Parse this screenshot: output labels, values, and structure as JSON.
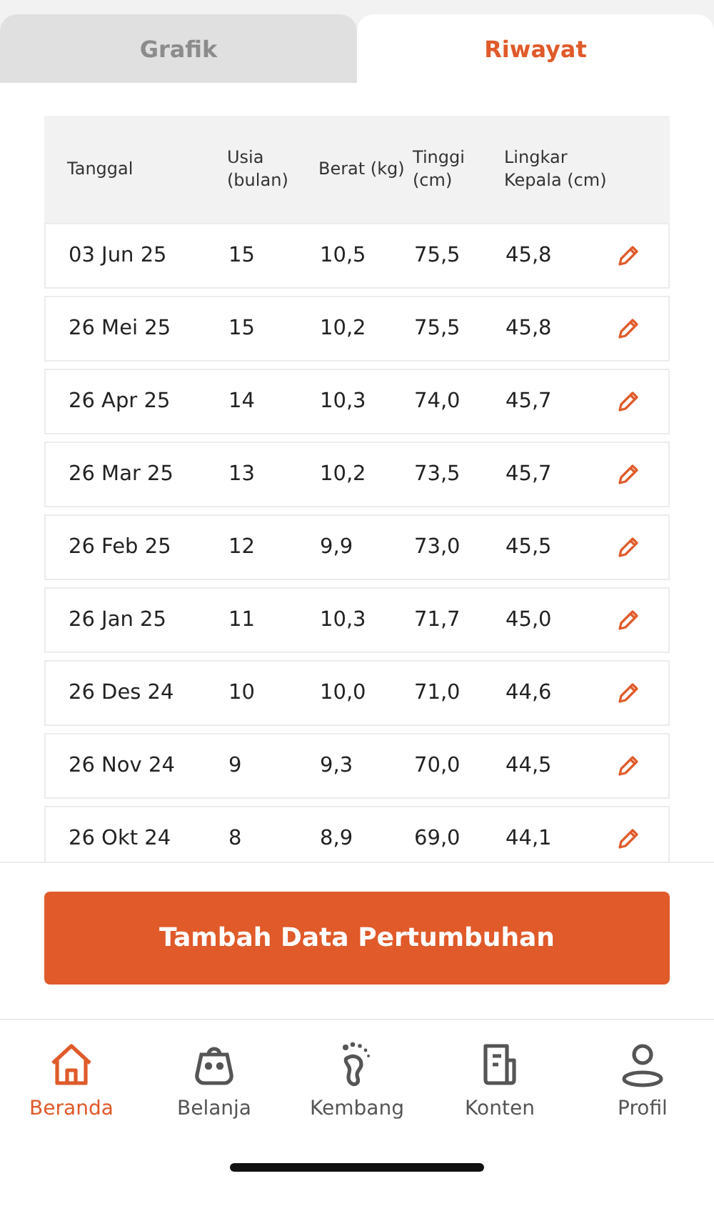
{
  "tabs": [
    {
      "label": "Grafik",
      "selected": false
    },
    {
      "label": "Riwayat",
      "selected": true
    }
  ],
  "table": {
    "columns": [
      "Tanggal",
      "Usia (bulan)",
      "Berat (kg)",
      "Tinggi (cm)",
      "Lingkar Kepala (cm)"
    ],
    "rows": [
      [
        "03 Jun 25",
        "15",
        "10,5",
        "75,5",
        "45,8"
      ],
      [
        "26 Mei 25",
        "15",
        "10,2",
        "75,5",
        "45,8"
      ],
      [
        "26 Apr 25",
        "14",
        "10,3",
        "74,0",
        "45,7"
      ],
      [
        "26 Mar 25",
        "13",
        "10,2",
        "73,5",
        "45,7"
      ],
      [
        "26 Feb 25",
        "12",
        "9,9",
        "73,0",
        "45,5"
      ],
      [
        "26 Jan 25",
        "11",
        "10,3",
        "71,7",
        "45,0"
      ],
      [
        "26 Des 24",
        "10",
        "10,0",
        "71,0",
        "44,6"
      ],
      [
        "26 Nov 24",
        "9",
        "9,3",
        "70,0",
        "44,5"
      ],
      [
        "26 Okt 24",
        "8",
        "8,9",
        "69,0",
        "44,1"
      ]
    ]
  },
  "add_button": "Tambah Data Pertumbuhan",
  "nav": [
    {
      "label": "Beranda",
      "kind": "home",
      "selected": true
    },
    {
      "label": "Belanja",
      "kind": "bag",
      "selected": false
    },
    {
      "label": "Kembang",
      "kind": "foot",
      "selected": false
    },
    {
      "label": "Konten",
      "kind": "doc",
      "selected": false
    },
    {
      "label": "Profil",
      "kind": "person",
      "selected": false
    }
  ]
}
